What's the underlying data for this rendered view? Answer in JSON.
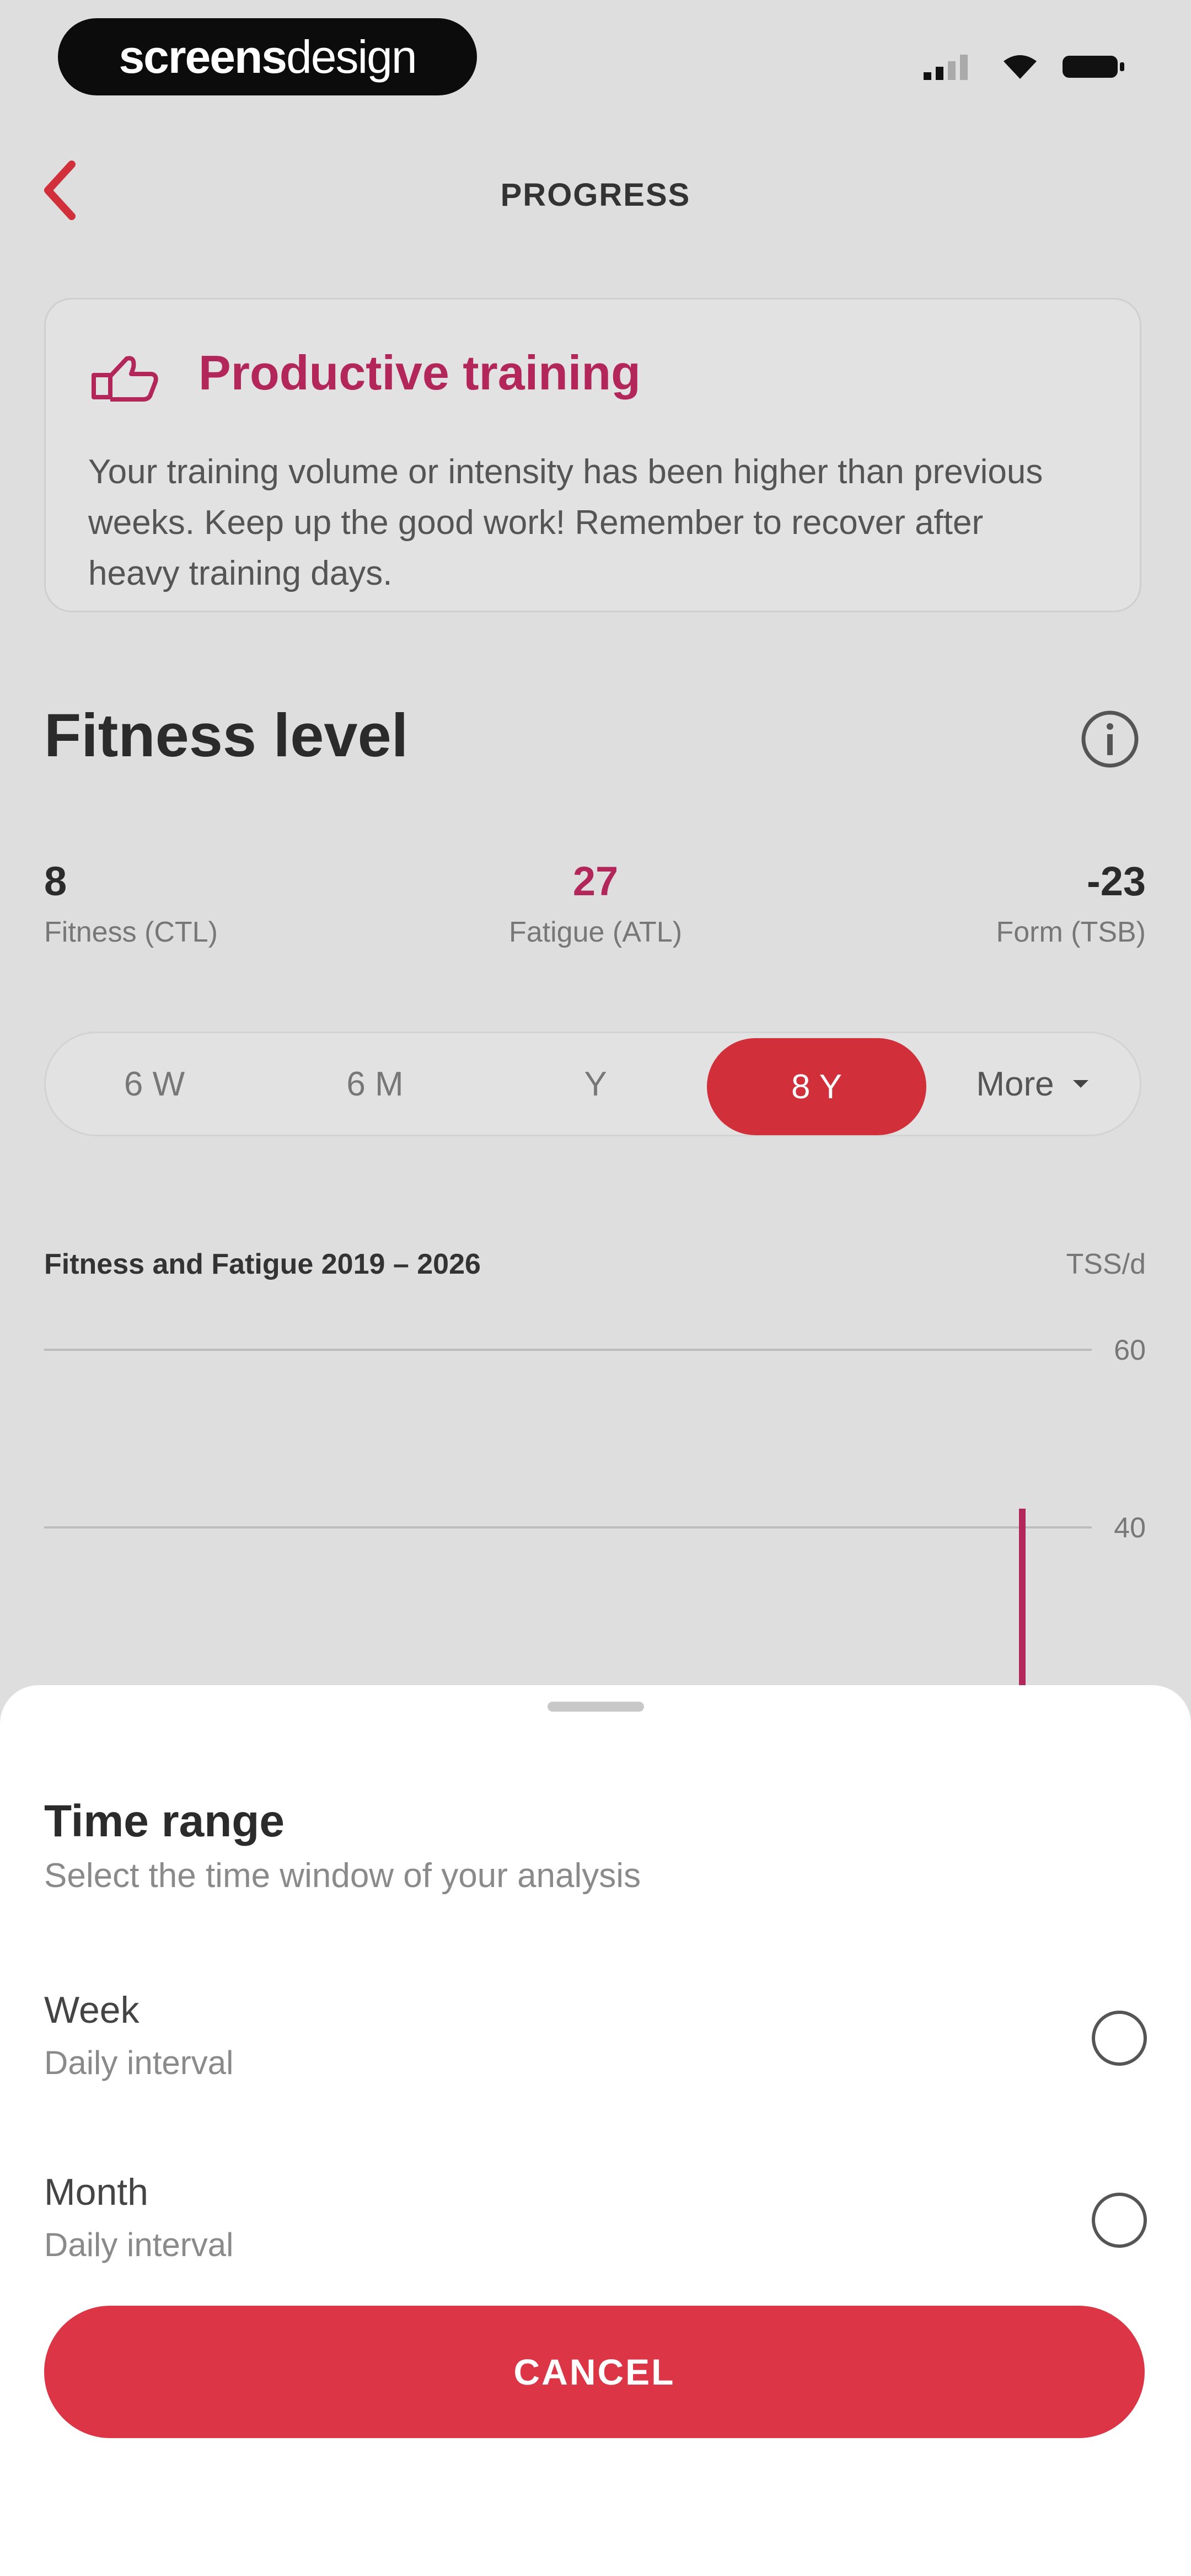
{
  "status_bar": {
    "brand_part1": "screens",
    "brand_part2": "design"
  },
  "header": {
    "title": "PROGRESS",
    "back_icon": "chevron-left-icon"
  },
  "insight": {
    "icon": "thumbs-up-icon",
    "title": "Productive training",
    "body": "Your training volume or intensity has been higher than previous weeks. Keep up the good work! Remember to recover after heavy training days."
  },
  "fitness": {
    "title": "Fitness level",
    "info_icon": "info-icon",
    "metrics": [
      {
        "value": "8",
        "label": "Fitness (CTL)"
      },
      {
        "value": "27",
        "label": "Fatigue (ATL)"
      },
      {
        "value": "-23",
        "label": "Form (TSB)"
      }
    ]
  },
  "range_tabs": {
    "items": [
      "6 W",
      "6 M",
      "Y",
      "8 Y"
    ],
    "active": "8 Y",
    "more_label": "More"
  },
  "chart_data": {
    "type": "line",
    "title": "Fitness and Fatigue 2019 – 2026",
    "ylabel": "TSS/d",
    "y_ticks": [
      "60",
      "40"
    ],
    "ylim": [
      0,
      60
    ]
  },
  "sheet": {
    "title": "Time range",
    "subtitle": "Select the time window of your analysis",
    "options": [
      {
        "label": "Week",
        "sub": "Daily interval"
      },
      {
        "label": "Month",
        "sub": "Daily interval"
      }
    ],
    "cancel_label": "CANCEL"
  },
  "colors": {
    "accent": "#dc3545",
    "highlight": "#b2265a",
    "overlay_bg": "#dedede"
  }
}
